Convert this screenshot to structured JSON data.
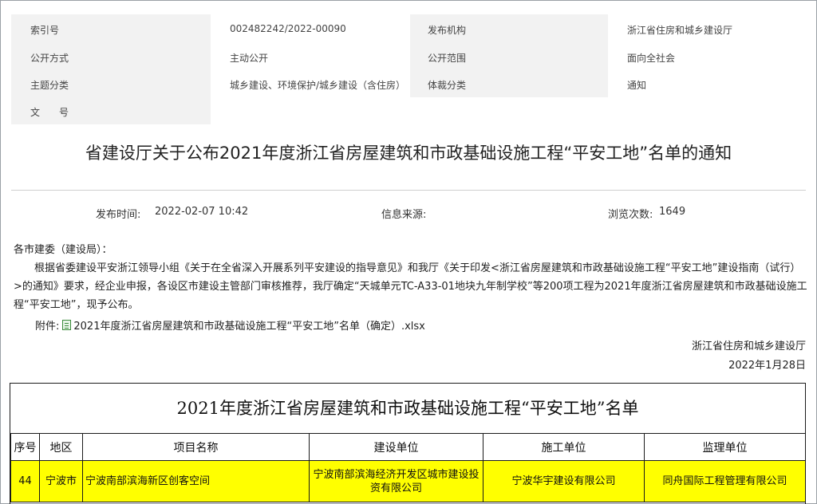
{
  "meta": {
    "index_label": "索引号",
    "index_value": "002482242/2022-00090",
    "publisher_label": "发布机构",
    "publisher_value": "浙江省住房和城乡建设厅",
    "open_mode_label": "公开方式",
    "open_mode_value": "主动公开",
    "open_scope_label": "公开范围",
    "open_scope_value": "面向全社会",
    "topic_label": "主题分类",
    "topic_value": "城乡建设、环境保护/城乡建设（含住房）",
    "genre_label": "体裁分类",
    "genre_value": "通知",
    "doc_no_label": "文　　号"
  },
  "article": {
    "title": "省建设厅关于公布2021年度浙江省房屋建筑和市政基础设施工程“平安工地”名单的通知",
    "publish_time_label": "发布时间:",
    "publish_time_value": "2022-02-07 10:42",
    "source_label": "信息来源:",
    "views_label": "浏览次数:",
    "views_value": "1649",
    "salutation": "各市建委（建设局）：",
    "body": "根据省委建设平安浙江领导小组《关于在全省深入开展系列平安建设的指导意见》和我厅《关于印发<浙江省房屋建筑和市政基础设施工程“平安工地”建设指南（试行）>的通知》要求，经企业申报，各设区市建设主管部门审核推荐，我厅确定“天城单元TC-A33-01地块九年制学校”等200项工程为2021年度浙江省房屋建筑和市政基础设施工程“平安工地”，现予公布。",
    "attachment_label": "附件:",
    "attachment_name": "2021年度浙江省房屋建筑和市政基础设施工程“平安工地”名单（确定）.xlsx",
    "sign_org": "浙江省住房和城乡建设厅",
    "sign_date": "2022年1月28日"
  },
  "list": {
    "title": "2021年度浙江省房屋建筑和市政基础设施工程“平安工地”名单",
    "headers": [
      "序号",
      "地区",
      "项目名称",
      "建设单位",
      "施工单位",
      "监理单位"
    ],
    "rows": [
      [
        "44",
        "宁波市",
        "宁波南部滨海新区创客空间",
        "宁波南部滨海经济开发区城市建设投资有限公司",
        "宁波华宇建设有限公司",
        "同舟国际工程管理有限公司"
      ]
    ]
  },
  "colors": {
    "highlight": "#ffff00",
    "meta_label_bg": "#f2f2f2"
  }
}
